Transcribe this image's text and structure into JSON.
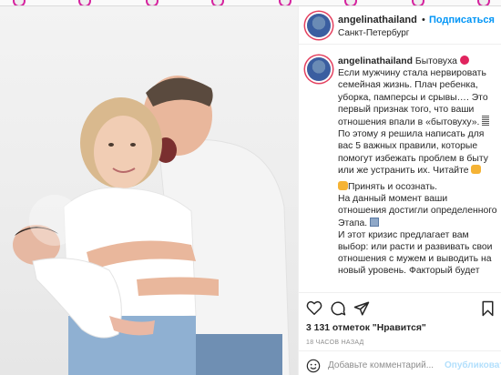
{
  "post": {
    "username": "angelinathailand",
    "follow_label": "Подписаться",
    "separator": "•",
    "location": "Санкт-Петербург",
    "photo_alt": "",
    "caption": {
      "username": "angelinathailand",
      "title": "Бытовуха",
      "p1": "Если мужчину стала нервировать семейная жизнь. Плач ребенка, уборка, памперсы и срывы…. Это первый признак того, что ваши отношения впали в «бытовуху».",
      "p2": "По этому я решила написать для вас 5 важных правили, которые помогут избежать проблем в быту или же устранить их. Читайте",
      "p3": "Принять и осознать.",
      "p4": "На данный момент ваши отношения достигли определенного Этапа.",
      "p5": "И этот кризис предлагает вам выбор: или расти и развивать свои отношения с мужем и выводить на новый уровень. Факторый будет"
    },
    "likes": "3 131 отметок \"Нравится\"",
    "time": "18 ЧАСОВ НАЗАД",
    "comment_placeholder": "Добавьте комментарий...",
    "publish_label": "Опубликовать",
    "colors": {
      "accent": "#0095f6",
      "text": "#262626",
      "muted": "#8e8e8e",
      "publish_disabled": "#b2dffc"
    },
    "icons": [
      "heart-icon",
      "comment-icon",
      "share-icon",
      "save-icon",
      "emoji-icon"
    ]
  }
}
